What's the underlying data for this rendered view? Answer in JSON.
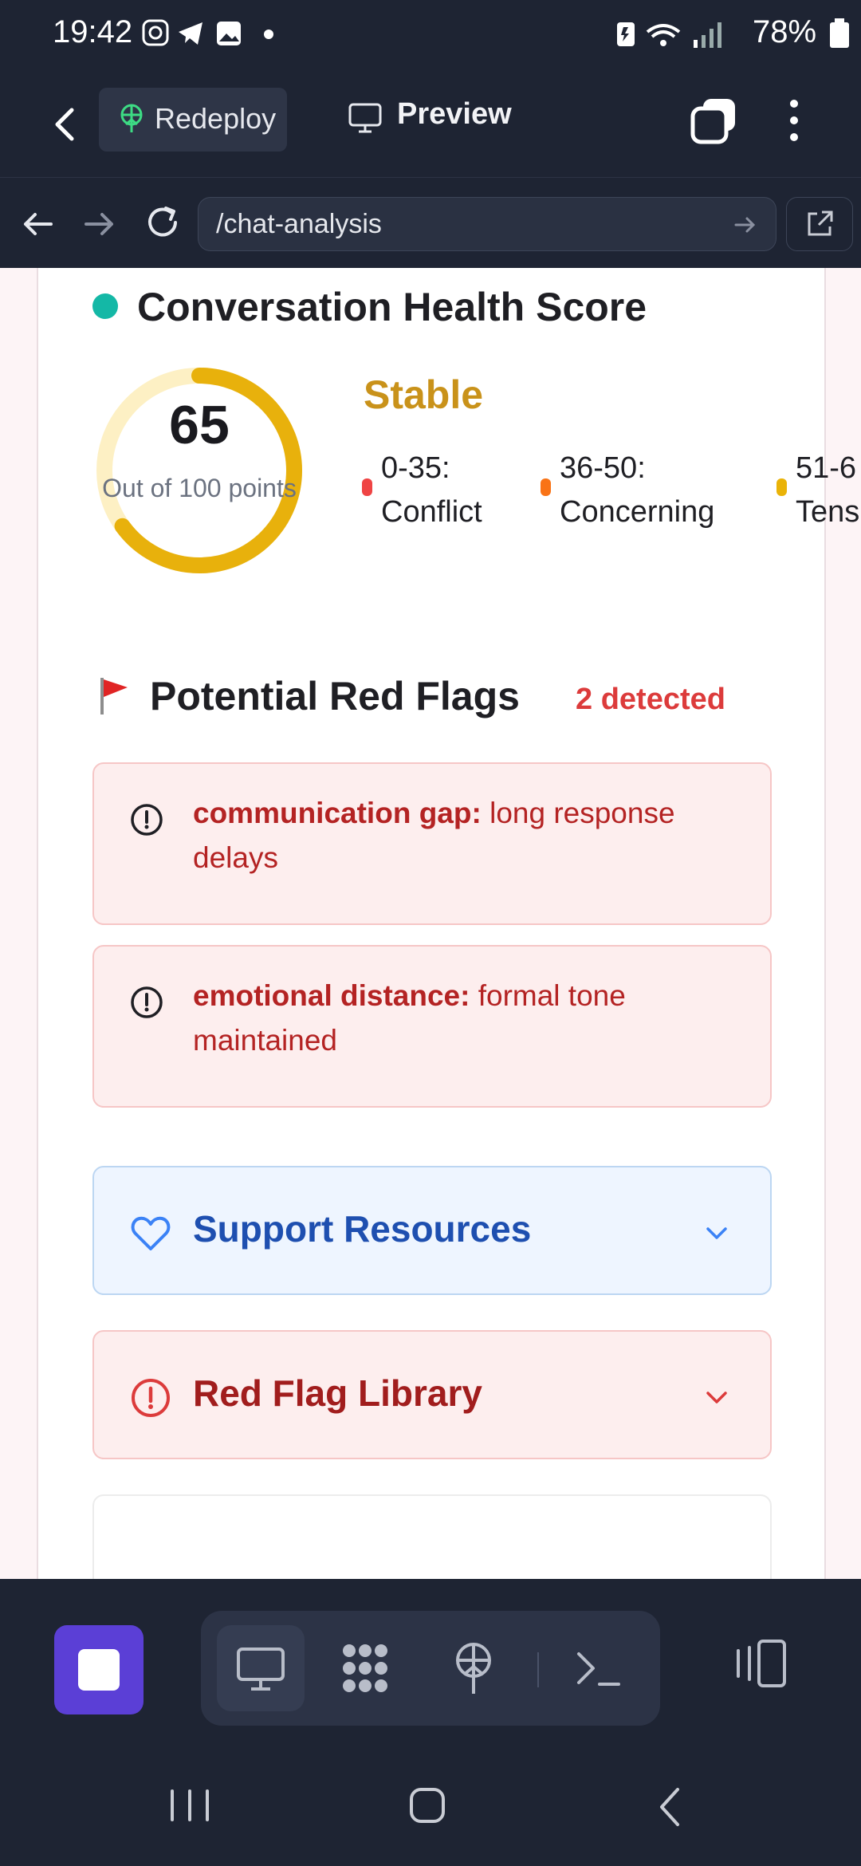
{
  "status_bar": {
    "time": "19:42",
    "battery": "78%"
  },
  "app_header": {
    "redeploy_label": "Redeploy",
    "preview_label": "Preview"
  },
  "url_bar": {
    "url": "/chat-analysis"
  },
  "health": {
    "title": "Conversation Health Score",
    "score": "65",
    "score_sub": "Out of 100 points",
    "score_fraction": 0.65,
    "status": "Stable",
    "legend": [
      {
        "range": "0-35:",
        "label": "Conflict",
        "color": "#ef4444"
      },
      {
        "range": "36-50:",
        "label": "Concerning",
        "color": "#f97316"
      },
      {
        "range": "51-6",
        "label": "Tens",
        "color": "#eab308"
      }
    ]
  },
  "red_flags": {
    "title": "Potential Red Flags",
    "count_label": "2 detected",
    "items": [
      {
        "name": "communication gap:",
        "detail": " long response delays"
      },
      {
        "name": "emotional distance:",
        "detail": " formal tone maintained"
      }
    ]
  },
  "accordions": {
    "support_label": "Support Resources",
    "library_label": "Red Flag Library"
  },
  "colors": {
    "accent_teal": "#14b8a6",
    "gauge_gold": "#e8b10c",
    "stable_gold": "#c9921a",
    "red": "#dc3b3b",
    "blue": "#1e4fb0",
    "stop_purple": "#5b3fd6"
  },
  "icons": {
    "back": "arrow-left-icon",
    "redeploy": "antenna-icon",
    "preview": "monitor-icon",
    "copy": "copy-icon",
    "more": "more-vertical-icon",
    "reload": "reload-icon",
    "external": "external-link-icon",
    "flag": "red-flag-icon",
    "alert": "alert-circle-icon",
    "heart": "heart-icon",
    "chevron": "chevron-down-icon"
  }
}
